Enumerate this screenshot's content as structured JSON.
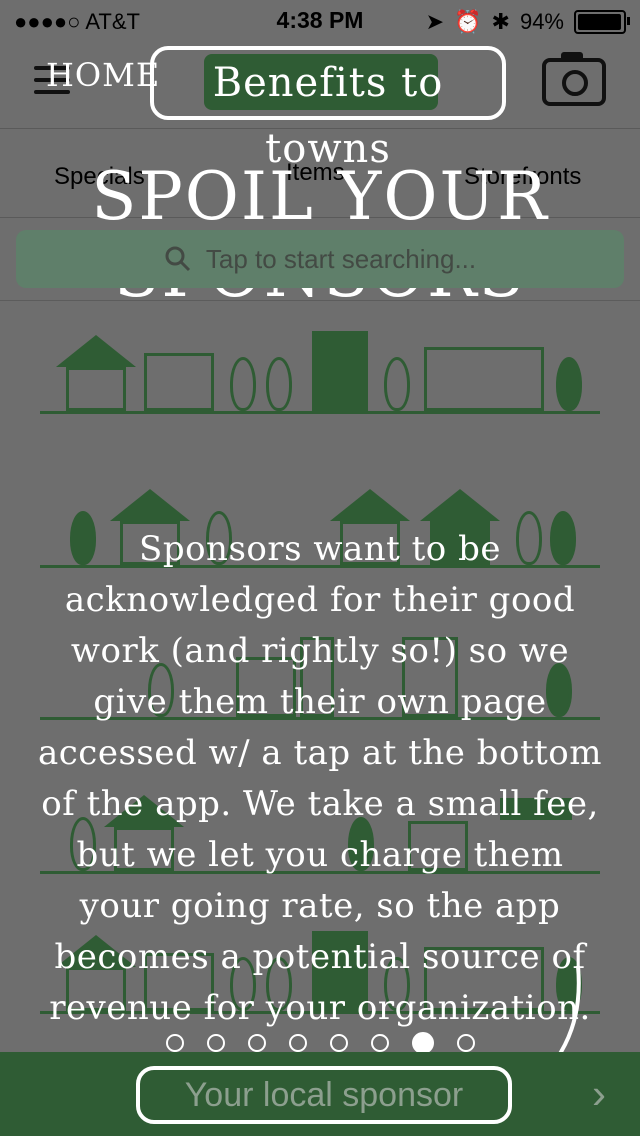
{
  "status_bar": {
    "carrier": "●●●●○ AT&T",
    "time": "4:38 PM",
    "battery": "94%"
  },
  "header": {
    "home_label": "HOME",
    "benefits_label": "Benefits to towns"
  },
  "tabs": [
    {
      "label": "Specials"
    },
    {
      "label": "Items"
    },
    {
      "label": "Storefronts"
    }
  ],
  "overlay_title": "SPOIL YOUR SPONSORS",
  "search": {
    "placeholder": "Tap to start searching..."
  },
  "description": "Sponsors want to be acknowledged for their good work (and rightly so!) so we give them their own page accessed w/ a tap at the bottom of the app. We take a small fee, but we let you charge them your going rate, so the app becomes a potential source of revenue for your organization.",
  "pagination": {
    "count": 8,
    "active_index": 6
  },
  "footer": {
    "sponsor_label": "Your local sponsor",
    "chevron": "›"
  },
  "colors": {
    "dim_overlay": "#6e6e6e",
    "brand_green": "#2f5c34"
  }
}
